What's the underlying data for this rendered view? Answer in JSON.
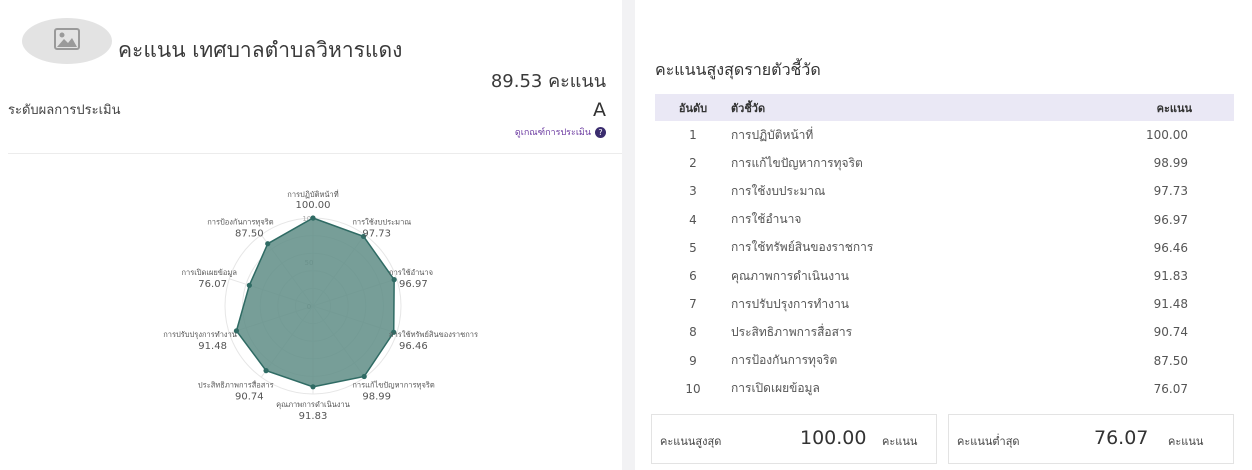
{
  "header": {
    "org_name": "คะแนน เทศบาลตำบลวิหารแดง",
    "total_score_value": "89.53",
    "total_score_unit": "คะแนน",
    "level_label": "ระดับผลการประเมิน",
    "level_value": "A",
    "criteria_link": "ดูเกณฑ์การประเมิน",
    "help_icon_glyph": "?"
  },
  "colors": {
    "accent": "#2f6b64",
    "radar_fill": "#5f8d86",
    "table_header_bg": "#eae8f5",
    "link": "#6b3aa0"
  },
  "chart_data": {
    "type": "radar",
    "categories": [
      "การปฏิบัติหน้าที่",
      "การใช้งบประมาณ",
      "การใช้อำนาจ",
      "การใช้ทรัพย์สินของราชการ",
      "การแก้ไขปัญหาการทุจริต",
      "คุณภาพการดำเนินงาน",
      "ประสิทธิภาพการสื่อสาร",
      "การปรับปรุงการทำงาน",
      "การเปิดเผยข้อมูล",
      "การป้องกันการทุจริต"
    ],
    "values": [
      100.0,
      97.73,
      96.97,
      96.46,
      98.99,
      91.83,
      90.74,
      91.48,
      76.07,
      87.5
    ],
    "value_labels": [
      "100.00",
      "97.73",
      "96.97",
      "96.46",
      "98.99",
      "91.83",
      "90.74",
      "91.48",
      "76.07",
      "87.50"
    ],
    "rlim": [
      0,
      100
    ],
    "tick_labels": [
      "0",
      "50",
      "100"
    ],
    "grid": true
  },
  "ranking": {
    "title": "คะแนนสูงสุดรายตัวชี้วัด",
    "columns": [
      "อันดับ",
      "ตัวชี้วัด",
      "คะแนน"
    ],
    "rows": [
      {
        "rank": "1",
        "name": "การปฏิบัติหน้าที่",
        "score": "100.00"
      },
      {
        "rank": "2",
        "name": "การแก้ไขปัญหาการทุจริต",
        "score": "98.99"
      },
      {
        "rank": "3",
        "name": "การใช้งบประมาณ",
        "score": "97.73"
      },
      {
        "rank": "4",
        "name": "การใช้อำนาจ",
        "score": "96.97"
      },
      {
        "rank": "5",
        "name": "การใช้ทรัพย์สินของราชการ",
        "score": "96.46"
      },
      {
        "rank": "6",
        "name": "คุณภาพการดำเนินงาน",
        "score": "91.83"
      },
      {
        "rank": "7",
        "name": "การปรับปรุงการทำงาน",
        "score": "91.48"
      },
      {
        "rank": "8",
        "name": "ประสิทธิภาพการสื่อสาร",
        "score": "90.74"
      },
      {
        "rank": "9",
        "name": "การป้องกันการทุจริต",
        "score": "87.50"
      },
      {
        "rank": "10",
        "name": "การเปิดเผยข้อมูล",
        "score": "76.07"
      }
    ]
  },
  "summary": {
    "max_label": "คะแนนสูงสุด",
    "max_value": "100.00",
    "min_label": "คะแนนต่ำสุด",
    "min_value": "76.07",
    "unit": "คะแนน"
  }
}
